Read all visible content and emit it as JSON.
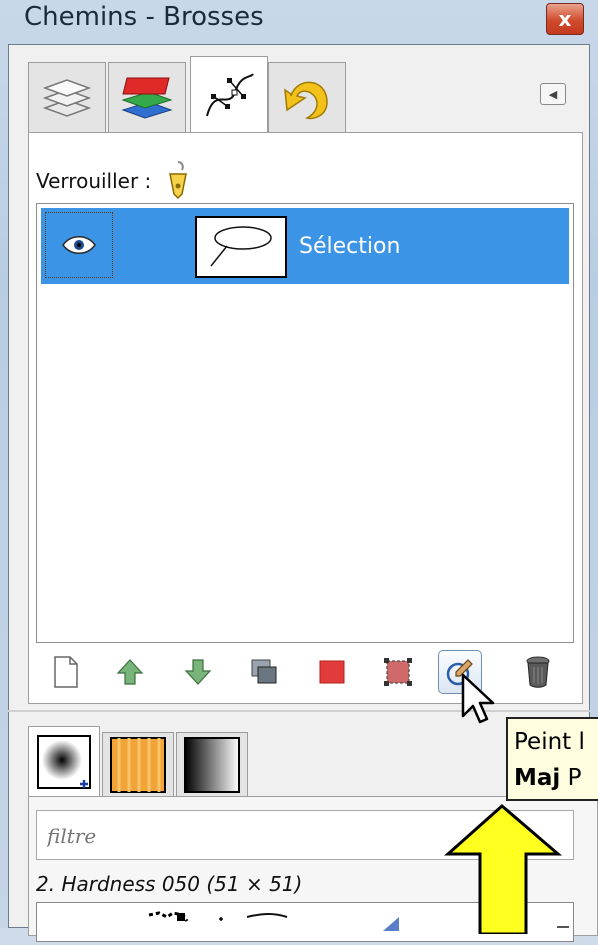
{
  "window": {
    "title": "Chemins - Brosses",
    "close_glyph": "x"
  },
  "dock_tabs": [
    {
      "icon": "layers-icon",
      "active": false
    },
    {
      "icon": "channels-icon",
      "active": false
    },
    {
      "icon": "paths-icon",
      "active": true
    },
    {
      "icon": "undo-history-icon",
      "active": false
    }
  ],
  "paths_panel": {
    "lock_label": "Verrouiller :",
    "rows": [
      {
        "label": "Sélection",
        "visible": true,
        "selected": true
      }
    ],
    "buttons": [
      {
        "name": "new-path-button",
        "icon": "new-document-icon"
      },
      {
        "name": "raise-path-button",
        "icon": "arrow-up-icon"
      },
      {
        "name": "lower-path-button",
        "icon": "arrow-down-icon"
      },
      {
        "name": "duplicate-path-button",
        "icon": "duplicate-icon"
      },
      {
        "name": "path-to-selection-button",
        "icon": "path-to-selection-icon"
      },
      {
        "name": "selection-to-path-button",
        "icon": "selection-to-path-icon"
      },
      {
        "name": "paint-along-path-button",
        "icon": "paint-along-path-icon"
      },
      {
        "name": "delete-path-button",
        "icon": "trash-icon"
      }
    ]
  },
  "tooltip": {
    "line1": "Peint l",
    "line2_bold": "Maj",
    "line2_rest": " P"
  },
  "brushes_panel": {
    "tabs": [
      {
        "icon": "brush-icon",
        "active": true
      },
      {
        "icon": "pattern-icon",
        "active": false
      },
      {
        "icon": "gradient-icon",
        "active": false
      }
    ],
    "filter_placeholder": "filtre",
    "selected_brush": "2. Hardness 050 (51 × 51)"
  },
  "colors": {
    "selection_blue": "#3b94e6",
    "tooltip_bg": "#fffde0",
    "arrow_yellow": "#ffff20"
  }
}
